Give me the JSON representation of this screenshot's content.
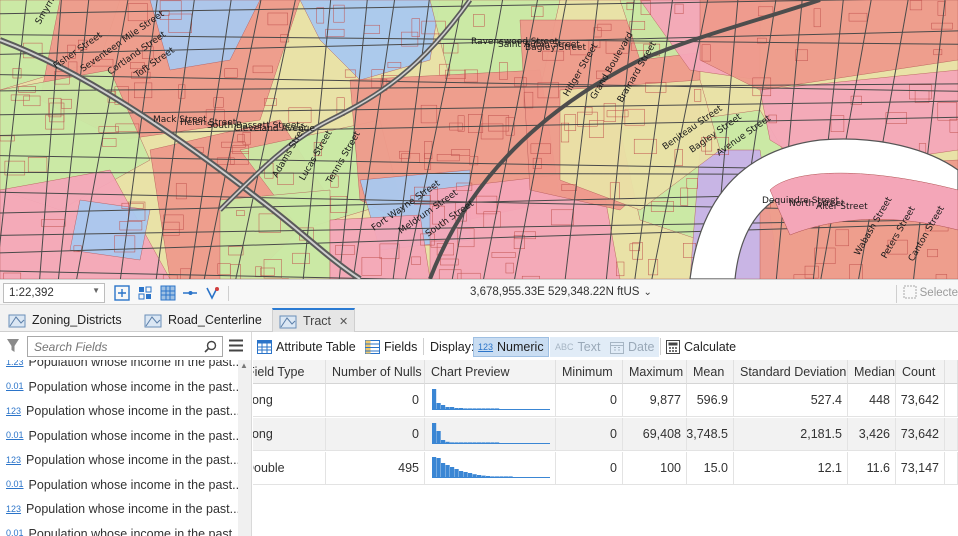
{
  "map": {
    "streets": [
      "Smyrna Street",
      "Toft Street",
      "Cleveland Avenue",
      "Tennis Street",
      "South Street",
      "Bagley Street",
      "Brainard Street",
      "Avenue Street",
      "Alter Street",
      "Canton Street",
      "Cortland Street",
      "South Bassett Street",
      "Lucas Street",
      "Meldrum Street",
      "Saint Aubin Street",
      "Grand Boulevard",
      "Bagley Street",
      "North Street",
      "Peters Street",
      "Seventeen Mile Street",
      "Helen Street",
      "Adams Street",
      "Fort Wayne Street",
      "Ravenswood Street",
      "Hillger Street",
      "Beniteau Street",
      "Dequindre Street",
      "Wabash Street",
      "Fisher Street",
      "Mack Street"
    ],
    "zones": {
      "residential": "#ee9a8b",
      "commercial": "#f4a6b8",
      "industrial": "#c7b2e8",
      "park": "#c9e9a4",
      "mixed": "#a9c8ef",
      "open": "#e9e2a6"
    }
  },
  "statusbar": {
    "scale": "1:22,392",
    "coordinates": "3,678,955.33E 529,348.22N ftUS",
    "selected": "Selecte"
  },
  "tabs": [
    {
      "label": "Zoning_Districts"
    },
    {
      "label": "Road_Centerline"
    },
    {
      "label": "Tract"
    }
  ],
  "fields_pane": {
    "search_placeholder": "Search Fields",
    "fields": [
      {
        "type": "1.23",
        "label": "Population whose income in the past..."
      },
      {
        "type": "0.01",
        "label": "Population whose income in the past..."
      },
      {
        "type": "123",
        "label": "Population whose income in the past..."
      },
      {
        "type": "0.01",
        "label": "Population whose income in the past..."
      },
      {
        "type": "123",
        "label": "Population whose income in the past..."
      },
      {
        "type": "0.01",
        "label": "Population whose income in the past..."
      },
      {
        "type": "123",
        "label": "Population whose income in the past..."
      },
      {
        "type": "0.01",
        "label": "Population whose income in the past..."
      }
    ]
  },
  "toolbar": {
    "attribute_table": "Attribute Table",
    "fields": "Fields",
    "display_label": "Display:",
    "numeric": "Numeric",
    "text": "Text",
    "date": "Date",
    "calculate": "Calculate"
  },
  "grid": {
    "headers": [
      "Field Type",
      "Number of Nulls",
      "Chart Preview",
      "Minimum",
      "Maximum",
      "Mean",
      "Standard Deviation",
      "Median",
      "Count"
    ],
    "rows": [
      {
        "field_type": "Long",
        "nulls": "0",
        "histogram": [
          10,
          3,
          2,
          1,
          1,
          0.5,
          0.5,
          0.3,
          0.2,
          0.1,
          0.1,
          0.1,
          0.1,
          0.1,
          0.1
        ],
        "minimum": "0",
        "maximum": "9,877",
        "mean": "596.9",
        "std": "527.4",
        "median": "448",
        "count": "73,642"
      },
      {
        "field_type": "Long",
        "nulls": "0",
        "histogram": [
          10,
          6,
          1.5,
          0.6,
          0.3,
          0.2,
          0.1,
          0.1,
          0.1,
          0.1,
          0.1,
          0.1,
          0.1,
          0.1,
          0.1
        ],
        "minimum": "0",
        "maximum": "69,408",
        "mean": "3,748.5",
        "std": "2,181.5",
        "median": "3,426",
        "count": "73,642"
      },
      {
        "field_type": "Double",
        "nulls": "495",
        "histogram": [
          10,
          9.5,
          7,
          6,
          5,
          4,
          3,
          2.5,
          2,
          1.4,
          1,
          0.7,
          0.5,
          0.3,
          0.2,
          0.1,
          0.1,
          0.1
        ],
        "minimum": "0",
        "maximum": "100",
        "mean": "15.0",
        "std": "12.1",
        "median": "11.6",
        "count": "73,147"
      }
    ]
  }
}
